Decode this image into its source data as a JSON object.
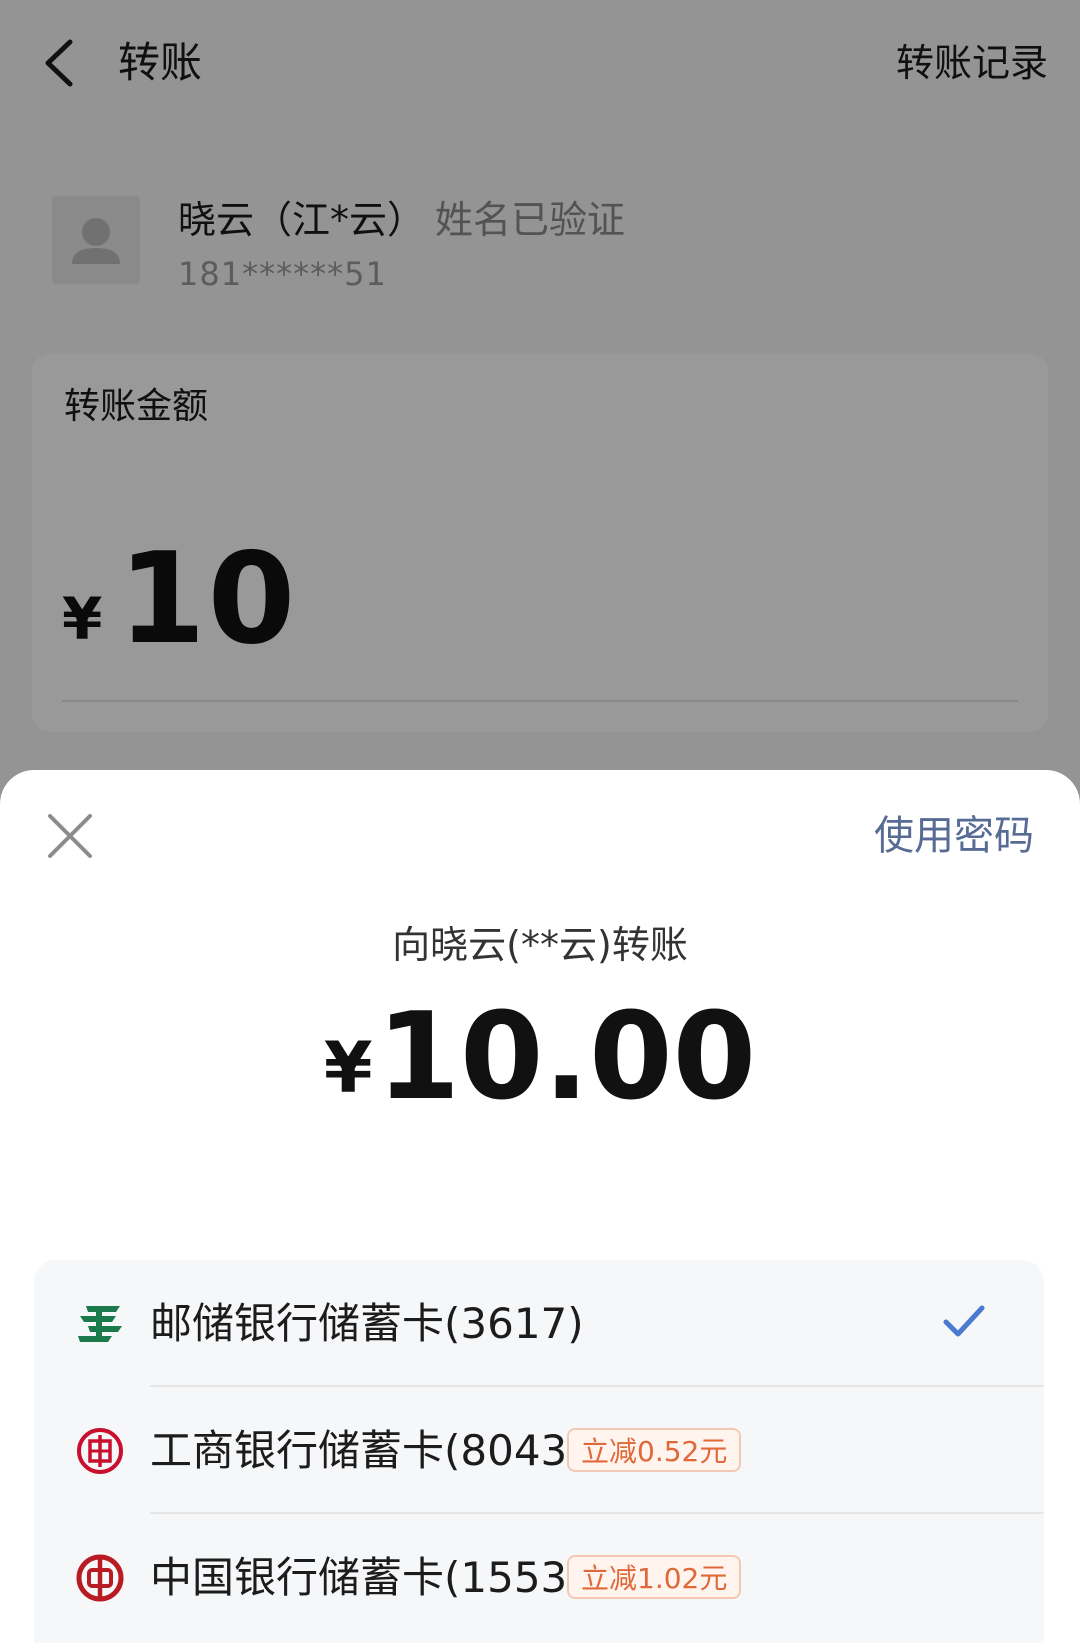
{
  "header": {
    "title": "转账",
    "history_label": "转账记录"
  },
  "payee": {
    "name": "晓云（江*云）",
    "verified_label": "姓名已验证",
    "phone": "181******51"
  },
  "amount_card": {
    "label": "转账金额",
    "currency": "¥",
    "value": "10"
  },
  "pay_sheet": {
    "use_password_label": "使用密码",
    "pay_to": "向晓云(**云)转账",
    "currency": "¥",
    "amount": "10.00",
    "cards": [
      {
        "bank": "邮储银行",
        "label": "邮储银行储蓄卡(3617)",
        "icon": "postal-savings-bank-icon",
        "selected": true,
        "discount": ""
      },
      {
        "bank": "工商银行",
        "label": "工商银行储蓄卡(8043)",
        "icon": "icbc-icon",
        "selected": false,
        "discount": "立减0.52元"
      },
      {
        "bank": "中国银行",
        "label": "中国银行储蓄卡(1553)",
        "icon": "bank-of-china-icon",
        "selected": false,
        "discount": "立减1.02元"
      }
    ]
  },
  "colors": {
    "link": "#576b95",
    "check": "#4a7bd0",
    "discount_text": "#e0693a",
    "discount_border": "#f3c9b4",
    "postal_green": "#1a7a4c",
    "icbc_red": "#c8102e",
    "boc_red": "#b81c22"
  }
}
